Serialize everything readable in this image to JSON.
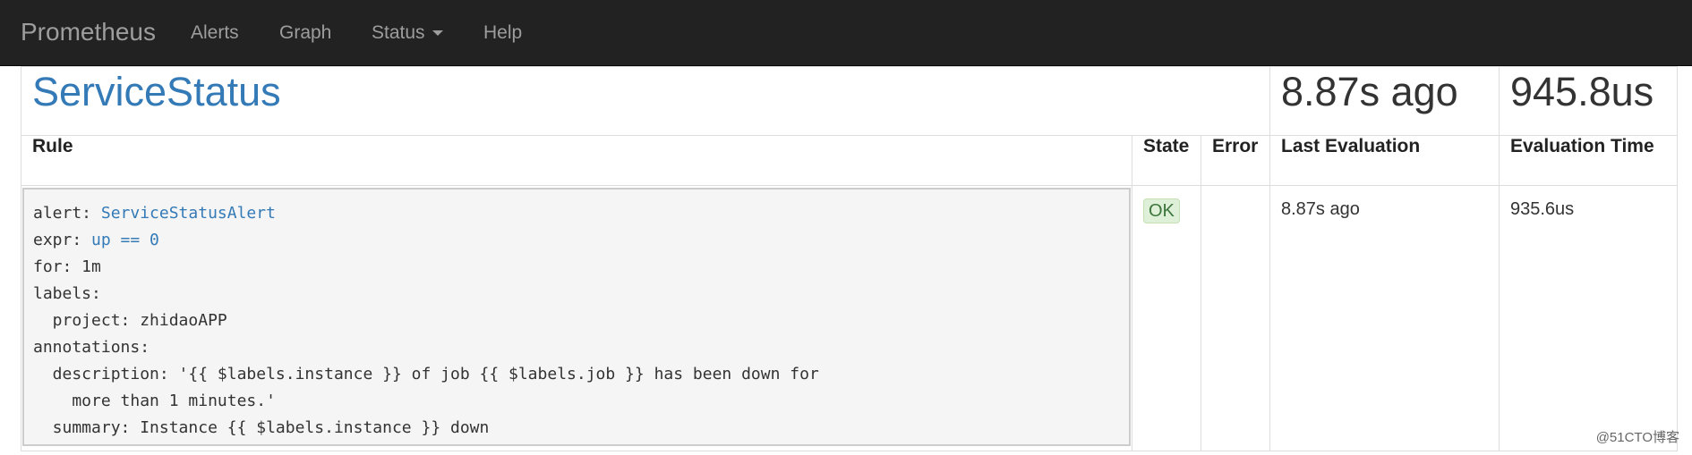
{
  "navbar": {
    "brand": "Prometheus",
    "items": [
      {
        "label": "Alerts"
      },
      {
        "label": "Graph"
      },
      {
        "label": "Status"
      },
      {
        "label": "Help"
      }
    ]
  },
  "group": {
    "name": "ServiceStatus",
    "last_evaluation": "8.87s ago",
    "evaluation_time": "945.8us"
  },
  "table": {
    "headers": {
      "rule": "Rule",
      "state": "State",
      "error": "Error",
      "last_evaluation": "Last Evaluation",
      "evaluation_time": "Evaluation Time"
    }
  },
  "rule": {
    "alert_key": "alert: ",
    "alert_name": "ServiceStatusAlert",
    "expr_key": "expr: ",
    "expr": "up == 0",
    "for_line": "for: 1m",
    "labels_line": "labels:",
    "label_project": "  project: zhidaoAPP",
    "annotations_line": "annotations:",
    "description_1": "  description: '{{ $labels.instance }} of job {{ $labels.job }} has been down for",
    "description_2": "    more than 1 minutes.'",
    "summary": "  summary: Instance {{ $labels.instance }} down",
    "state": "OK",
    "error": "",
    "last_evaluation": "8.87s ago",
    "evaluation_time": "935.6us"
  },
  "watermark": "@51CTO博客"
}
